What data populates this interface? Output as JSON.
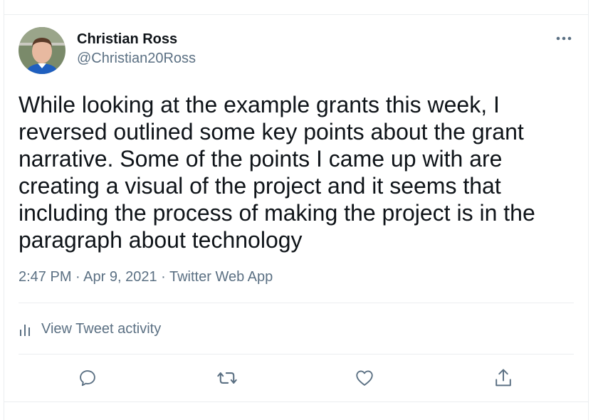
{
  "tweet": {
    "author": {
      "display_name": "Christian Ross",
      "handle": "@Christian20Ross",
      "avatar_icon": "user-avatar"
    },
    "text": "While looking at the example grants this week, I reversed outlined some key points about the grant narrative. Some of the points I came up with are creating a visual of the project and it seems that including the process of making the project is in the paragraph about technology",
    "time": "2:47 PM",
    "separator": " · ",
    "date": "Apr 9, 2021",
    "source": "Twitter Web App",
    "activity_label": "View Tweet activity",
    "actions": [
      {
        "name": "reply",
        "icon": "reply-icon"
      },
      {
        "name": "retweet",
        "icon": "retweet-icon"
      },
      {
        "name": "like",
        "icon": "heart-icon"
      },
      {
        "name": "share",
        "icon": "share-icon"
      }
    ]
  },
  "colors": {
    "text_primary": "#0f1419",
    "text_secondary": "#5b7083",
    "divider": "#ebeef0"
  }
}
